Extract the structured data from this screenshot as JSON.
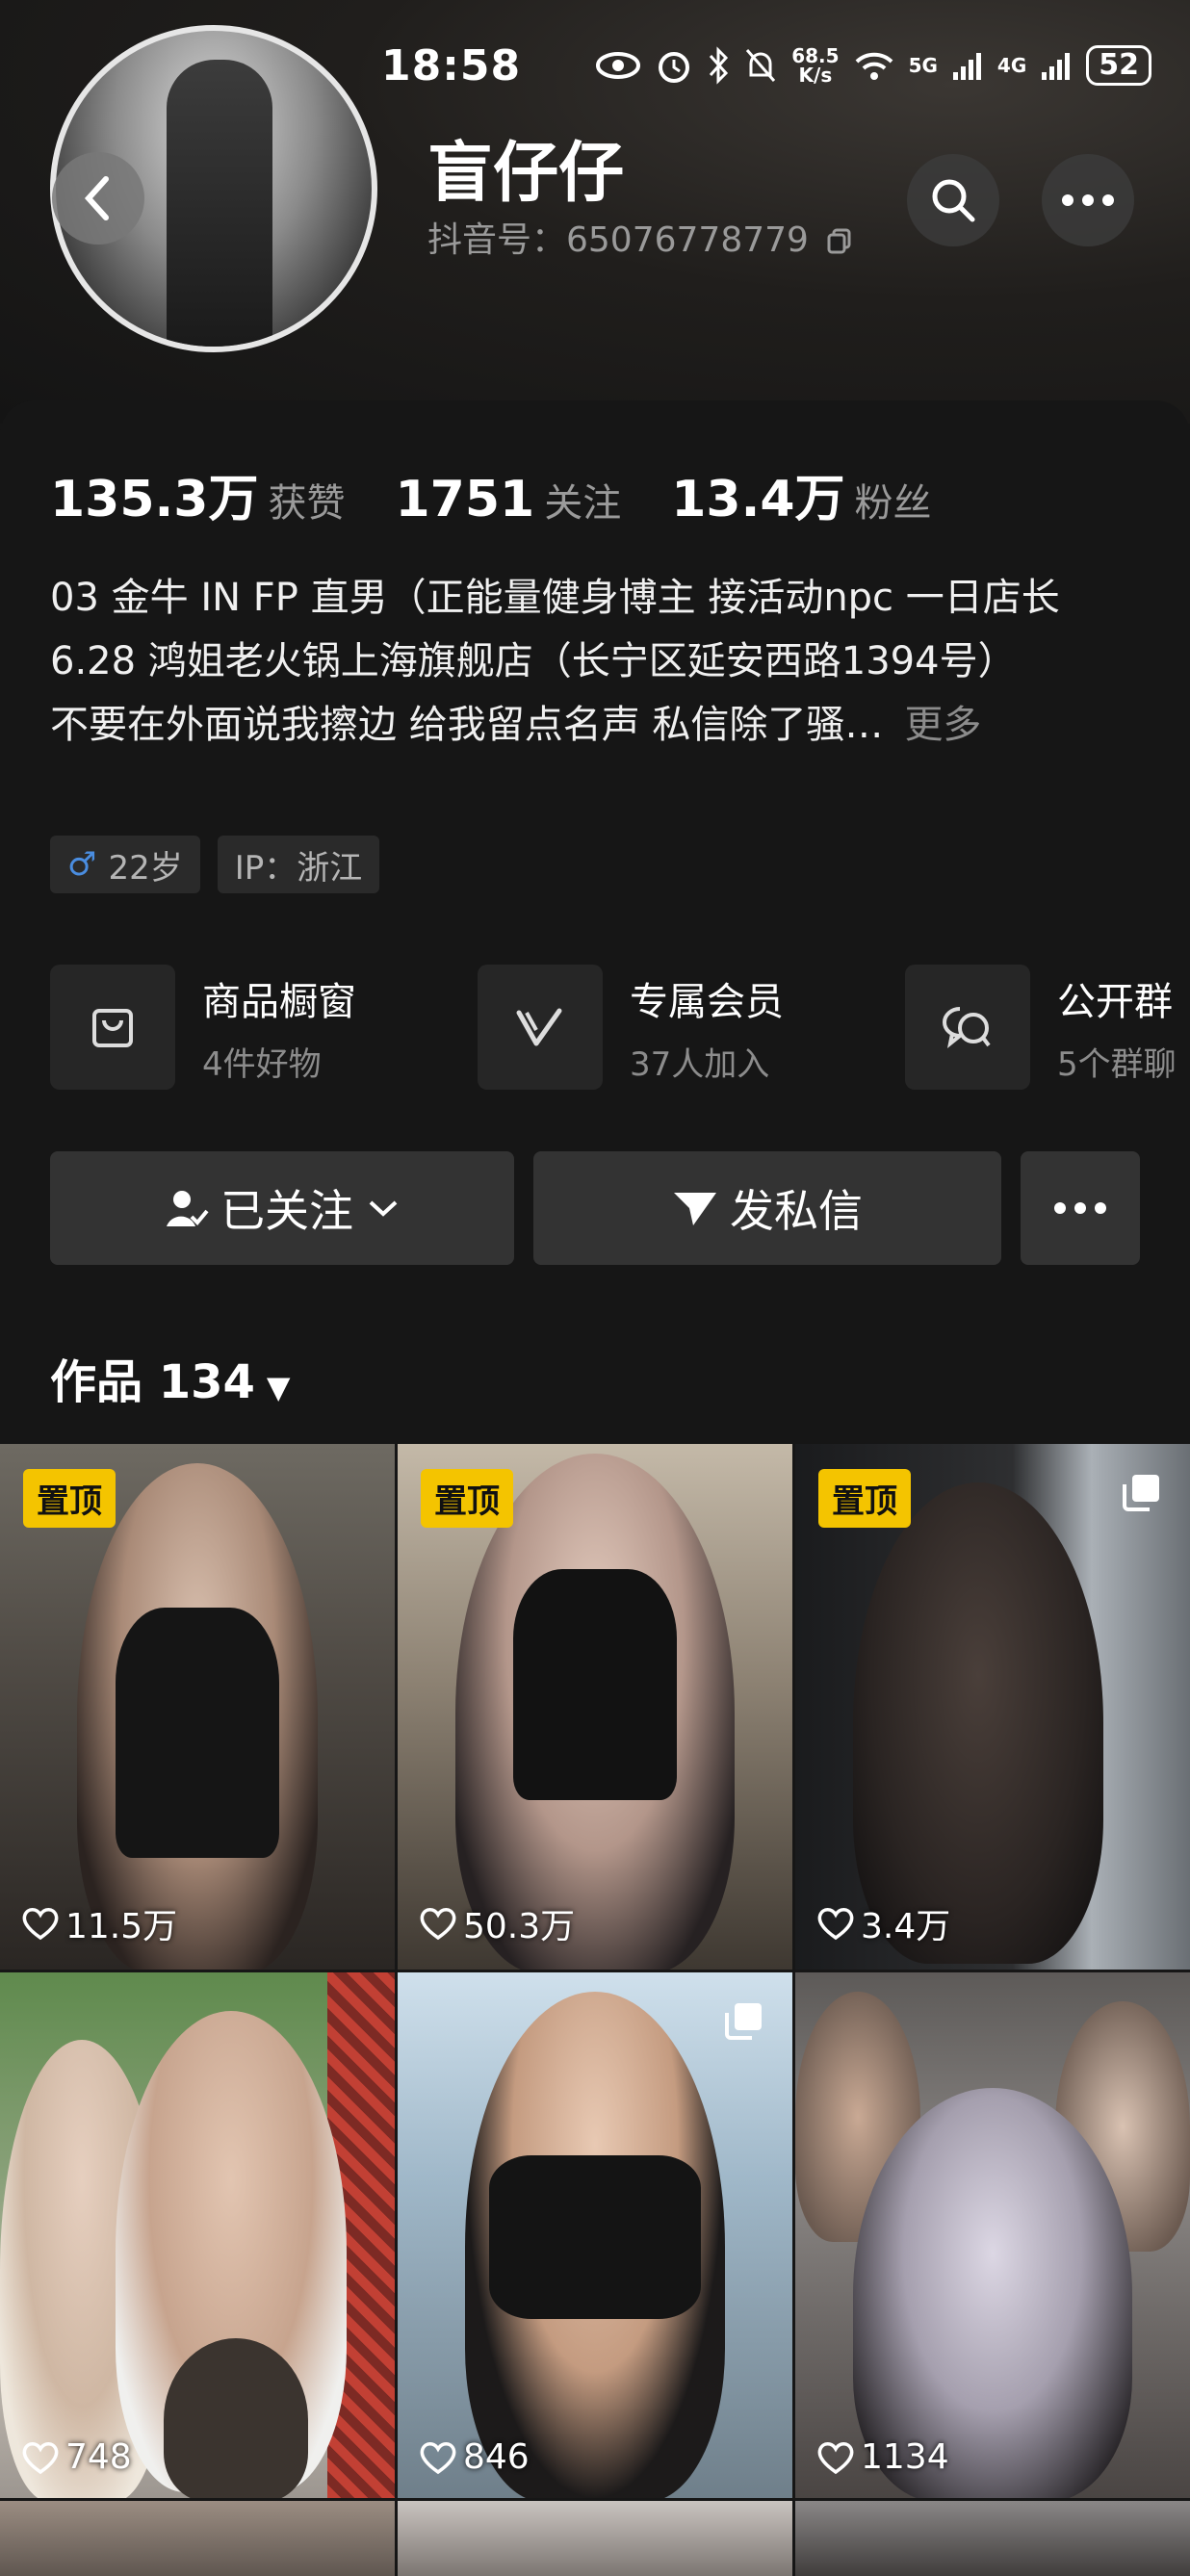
{
  "status_bar": {
    "time": "18:58",
    "net_speed_top": "68.5",
    "net_speed_unit": "K/s",
    "sim1": "5G",
    "sim2": "4G",
    "battery": "52"
  },
  "profile": {
    "name": "盲仔仔",
    "douyin_id": "抖音号：65076778779"
  },
  "stats": [
    {
      "value": "135.3万",
      "label": "获赞"
    },
    {
      "value": "1751",
      "label": "关注"
    },
    {
      "value": "13.4万",
      "label": "粉丝"
    }
  ],
  "bio": {
    "line1": "03 金牛 IN FP 直男（正能量健身博主 接活动npc 一日店长",
    "line2": "6.28 鸿姐老火锅上海旗舰店（长宁区延安西路1394号）",
    "line3": "不要在外面说我擦边 给我留点名声 私信除了骚…",
    "more": "更多"
  },
  "tags": {
    "gender_icon": "♂",
    "age": "22岁",
    "ip": "IP：浙江"
  },
  "features": [
    {
      "icon": "shopping-bag-icon",
      "title": "商品橱窗",
      "sub": "4件好物"
    },
    {
      "icon": "vip-v-icon",
      "title": "专属会员",
      "sub": "37人加入"
    },
    {
      "icon": "group-chat-icon",
      "title": "公开群",
      "sub": "5个群聊"
    }
  ],
  "actions": {
    "follow": "已关注",
    "message": "发私信",
    "more": "•••"
  },
  "works": {
    "label": "作品 134"
  },
  "grid": [
    {
      "pinned": true,
      "pin_label": "置顶",
      "likes": "11.5万",
      "multi": false
    },
    {
      "pinned": true,
      "pin_label": "置顶",
      "likes": "50.3万",
      "multi": false
    },
    {
      "pinned": true,
      "pin_label": "置顶",
      "likes": "3.4万",
      "multi": true
    },
    {
      "pinned": false,
      "likes": "748",
      "multi": false
    },
    {
      "pinned": false,
      "likes": "846",
      "multi": true
    },
    {
      "pinned": false,
      "likes": "1134",
      "multi": false
    }
  ],
  "colors": {
    "background": "#161616",
    "pin_badge": "#f4c400",
    "muted_text": "#9a9a9a",
    "button_bg": "#333333"
  }
}
